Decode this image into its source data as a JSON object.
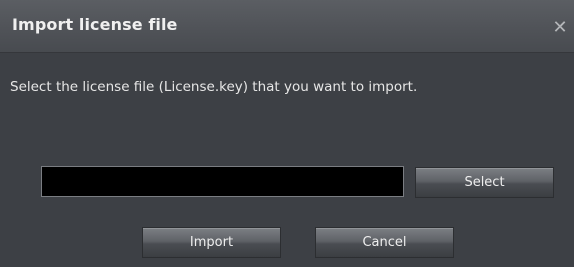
{
  "dialog": {
    "title": "Import license file",
    "close_glyph": "✕",
    "instructions": "Select the license file (License.key) that you want to import.",
    "file_path_value": "",
    "select_label": "Select",
    "import_label": "Import",
    "cancel_label": "Cancel"
  },
  "colors": {
    "background": "#3d4045",
    "titlebar": "#505358",
    "input_background": "#000000",
    "text": "#e6e6e6"
  },
  "icons": {
    "close": "close-icon"
  }
}
